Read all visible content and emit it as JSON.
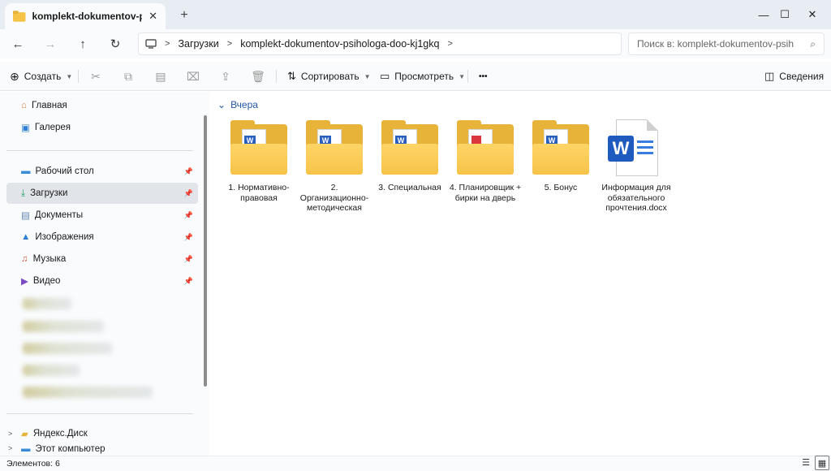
{
  "window": {
    "tab_title": "komplekt-dokumentov-psihologa",
    "tab_close": "✕",
    "new_tab": "+",
    "minimize": "—",
    "maximize": "☐",
    "close": "✕"
  },
  "address": {
    "crumbs": [
      "Загрузки",
      "komplekt-dokumentov-psihologa-doo-kj1gkq"
    ],
    "search_placeholder": "Поиск в: komplekt-dokumentov-psih"
  },
  "commands": {
    "create": "Создать",
    "sort": "Сортировать",
    "view": "Просмотреть",
    "more": "•••",
    "details": "Сведения"
  },
  "sidebar": {
    "items": [
      {
        "label": "Главная",
        "icon": "home-icon"
      },
      {
        "label": "Галерея",
        "icon": "gallery-icon"
      },
      {
        "label": "Рабочий стол",
        "icon": "desktop-icon"
      },
      {
        "label": "Загрузки",
        "icon": "download-icon"
      },
      {
        "label": "Документы",
        "icon": "documents-icon"
      },
      {
        "label": "Изображения",
        "icon": "pictures-icon"
      },
      {
        "label": "Музыка",
        "icon": "music-icon"
      },
      {
        "label": "Видео",
        "icon": "video-icon"
      },
      {
        "label": "Яндекс.Диск",
        "icon": "yandex-disk-icon"
      },
      {
        "label": "Этот компьютер",
        "icon": "computer-icon"
      }
    ]
  },
  "main": {
    "group": "Вчера",
    "files": [
      {
        "name": "1. Нормативно-правовая",
        "type": "folder",
        "preview": "word"
      },
      {
        "name": "2. Организационно-методическая",
        "type": "folder",
        "preview": "word"
      },
      {
        "name": "3. Специальная",
        "type": "folder",
        "preview": "word"
      },
      {
        "name": "4. Планировщик + бирки на дверь",
        "type": "folder",
        "preview": "pdf"
      },
      {
        "name": "5. Бонус",
        "type": "folder",
        "preview": "word"
      },
      {
        "name": "Информация для обязательного прочтения.docx",
        "type": "docx",
        "preview": "word"
      }
    ]
  },
  "status": {
    "count": "Элементов: 6"
  },
  "colors": {
    "accent": "#2457a6",
    "folder": "#f6c349",
    "word": "#1f5bbf",
    "selected": "#e1e4e8"
  }
}
